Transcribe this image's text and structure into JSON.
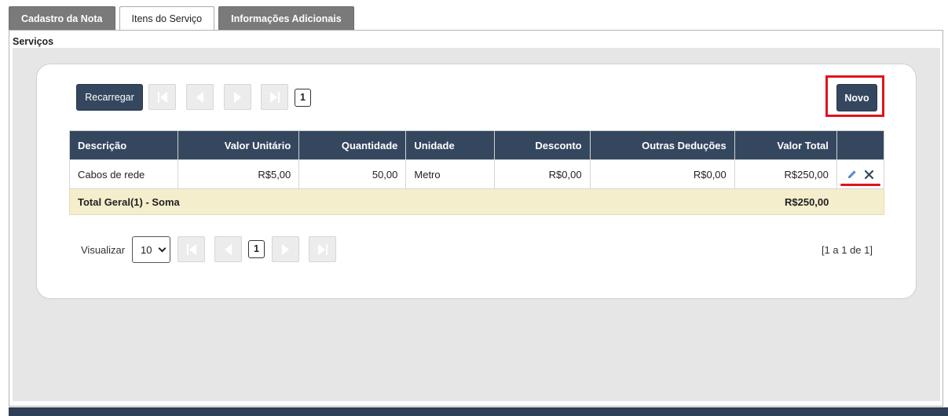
{
  "tabs": [
    {
      "label": "Cadastro da Nota",
      "active": false
    },
    {
      "label": "Itens do Serviço",
      "active": true
    },
    {
      "label": "Informações Adicionais",
      "active": false
    }
  ],
  "section_title": "Serviços",
  "toolbar": {
    "reload_label": "Recarregar",
    "new_label": "Novo",
    "current_page": "1"
  },
  "table": {
    "columns": [
      "Descrição",
      "Valor Unitário",
      "Quantidade",
      "Unidade",
      "Desconto",
      "Outras Deduções",
      "Valor Total"
    ],
    "rows": [
      {
        "descricao": "Cabos de rede",
        "valor_unitario": "R$5,00",
        "quantidade": "50,00",
        "unidade": "Metro",
        "desconto": "R$0,00",
        "outras_deducoes": "R$0,00",
        "valor_total": "R$250,00"
      }
    ],
    "total_label": "Total Geral(1) - Soma",
    "total_value": "R$250,00"
  },
  "footer": {
    "view_label": "Visualizar",
    "page_size": "10",
    "current_page": "1",
    "range_text": "[1 a 1 de 1]"
  },
  "colors": {
    "header_bg": "#34475f",
    "total_bg": "#f5eecd",
    "highlight": "#e0131e"
  }
}
